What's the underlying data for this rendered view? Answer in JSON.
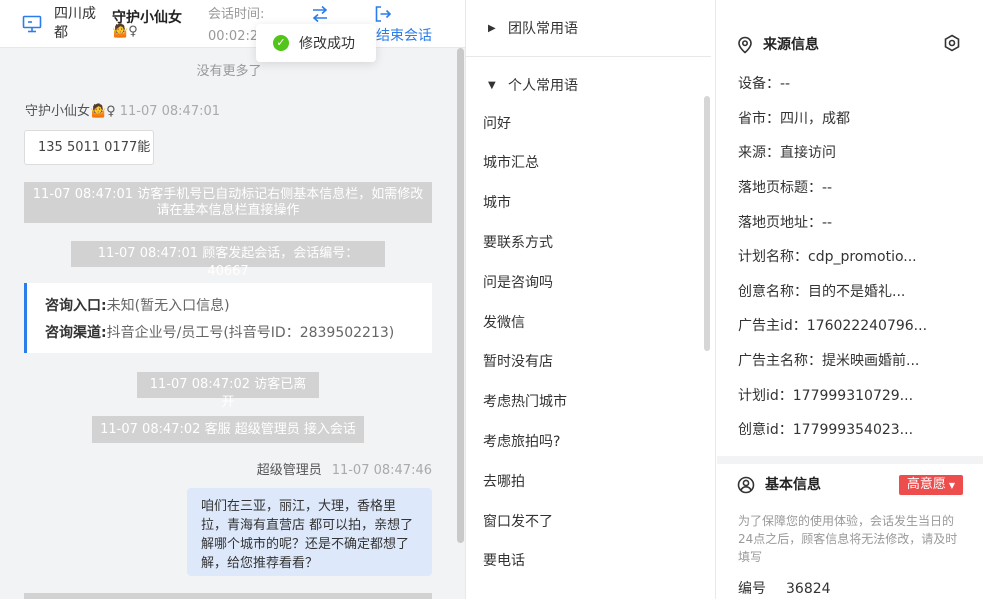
{
  "header": {
    "location": "四川成都",
    "visitor_name": "守护小仙女",
    "visitor_emoji": "🤷",
    "visitor_gender": "♀",
    "session_time_label": "会话时间:",
    "session_time_value": "00:02:26",
    "transfer_icon": "transfer-arrows-icon",
    "end_session_label": "结束会话"
  },
  "toast": {
    "text": "修改成功"
  },
  "chat": {
    "no_more": "没有更多了",
    "visitor_sender": "守护小仙女🤷♀",
    "visitor_time": "11-07 08:47:01",
    "phone_message": "135 5011 0177能",
    "system_msg_1": "11-07 08:47:01 访客手机号已自动标记右侧基本信息栏，如需修改请在基本信息栏直接操作",
    "system_msg_2": "11-07 08:47:01 顾客发起会话，会话编号：40667",
    "consult_entry_label": "咨询入口:",
    "consult_entry_value": "未知(暂无入口信息)",
    "consult_channel_label": "咨询渠道:",
    "consult_channel_value": "抖音企业号/员工号(抖音号ID：2839502213)",
    "system_msg_3": "11-07 08:47:02 访客已离开",
    "system_msg_4": "11-07 08:47:02 客服 超级管理员 接入会话",
    "agent_sender": "超级管理员",
    "agent_time": "11-07 08:47:46",
    "agent_message": "咱们在三亚，丽江，大理，香格里拉，青海有直营店 都可以拍，亲想了解哪个城市的呢？还是不确定都想了解，给您推荐看看？"
  },
  "phrases": {
    "team_group": "团队常用语",
    "personal_group": "个人常用语",
    "items": [
      "问好",
      "城市汇总",
      "城市",
      "要联系方式",
      "问是咨询吗",
      "发微信",
      "暂时没有店",
      "考虑热门城市",
      "考虑旅拍吗?",
      "去哪拍",
      "窗口发不了",
      "要电话"
    ]
  },
  "source_info": {
    "title": "来源信息",
    "rows": [
      "设备：--",
      "省市：四川，成都",
      "来源：直接访问",
      "落地页标题：--",
      "落地页地址：--",
      "计划名称：cdp_promotio...",
      "创意名称：目的不是婚礼...",
      "广告主id：176022240796...",
      "广告主名称：提米映画婚前...",
      "计划id：177999310729...",
      "创意id：177999354023..."
    ]
  },
  "basic_info": {
    "title": "基本信息",
    "intent_badge": "高意愿",
    "note": "为了保障您的使用体验，会话发生当日的24点之后，顾客信息将无法修改，请及时填写",
    "id_label": "编号",
    "id_value": "36824"
  },
  "colors": {
    "accent": "#2b7de9",
    "success": "#52c41a",
    "danger": "#ee4d4d",
    "agent_bubble": "#dde9fb",
    "system_msg": "#d2d2d2"
  }
}
